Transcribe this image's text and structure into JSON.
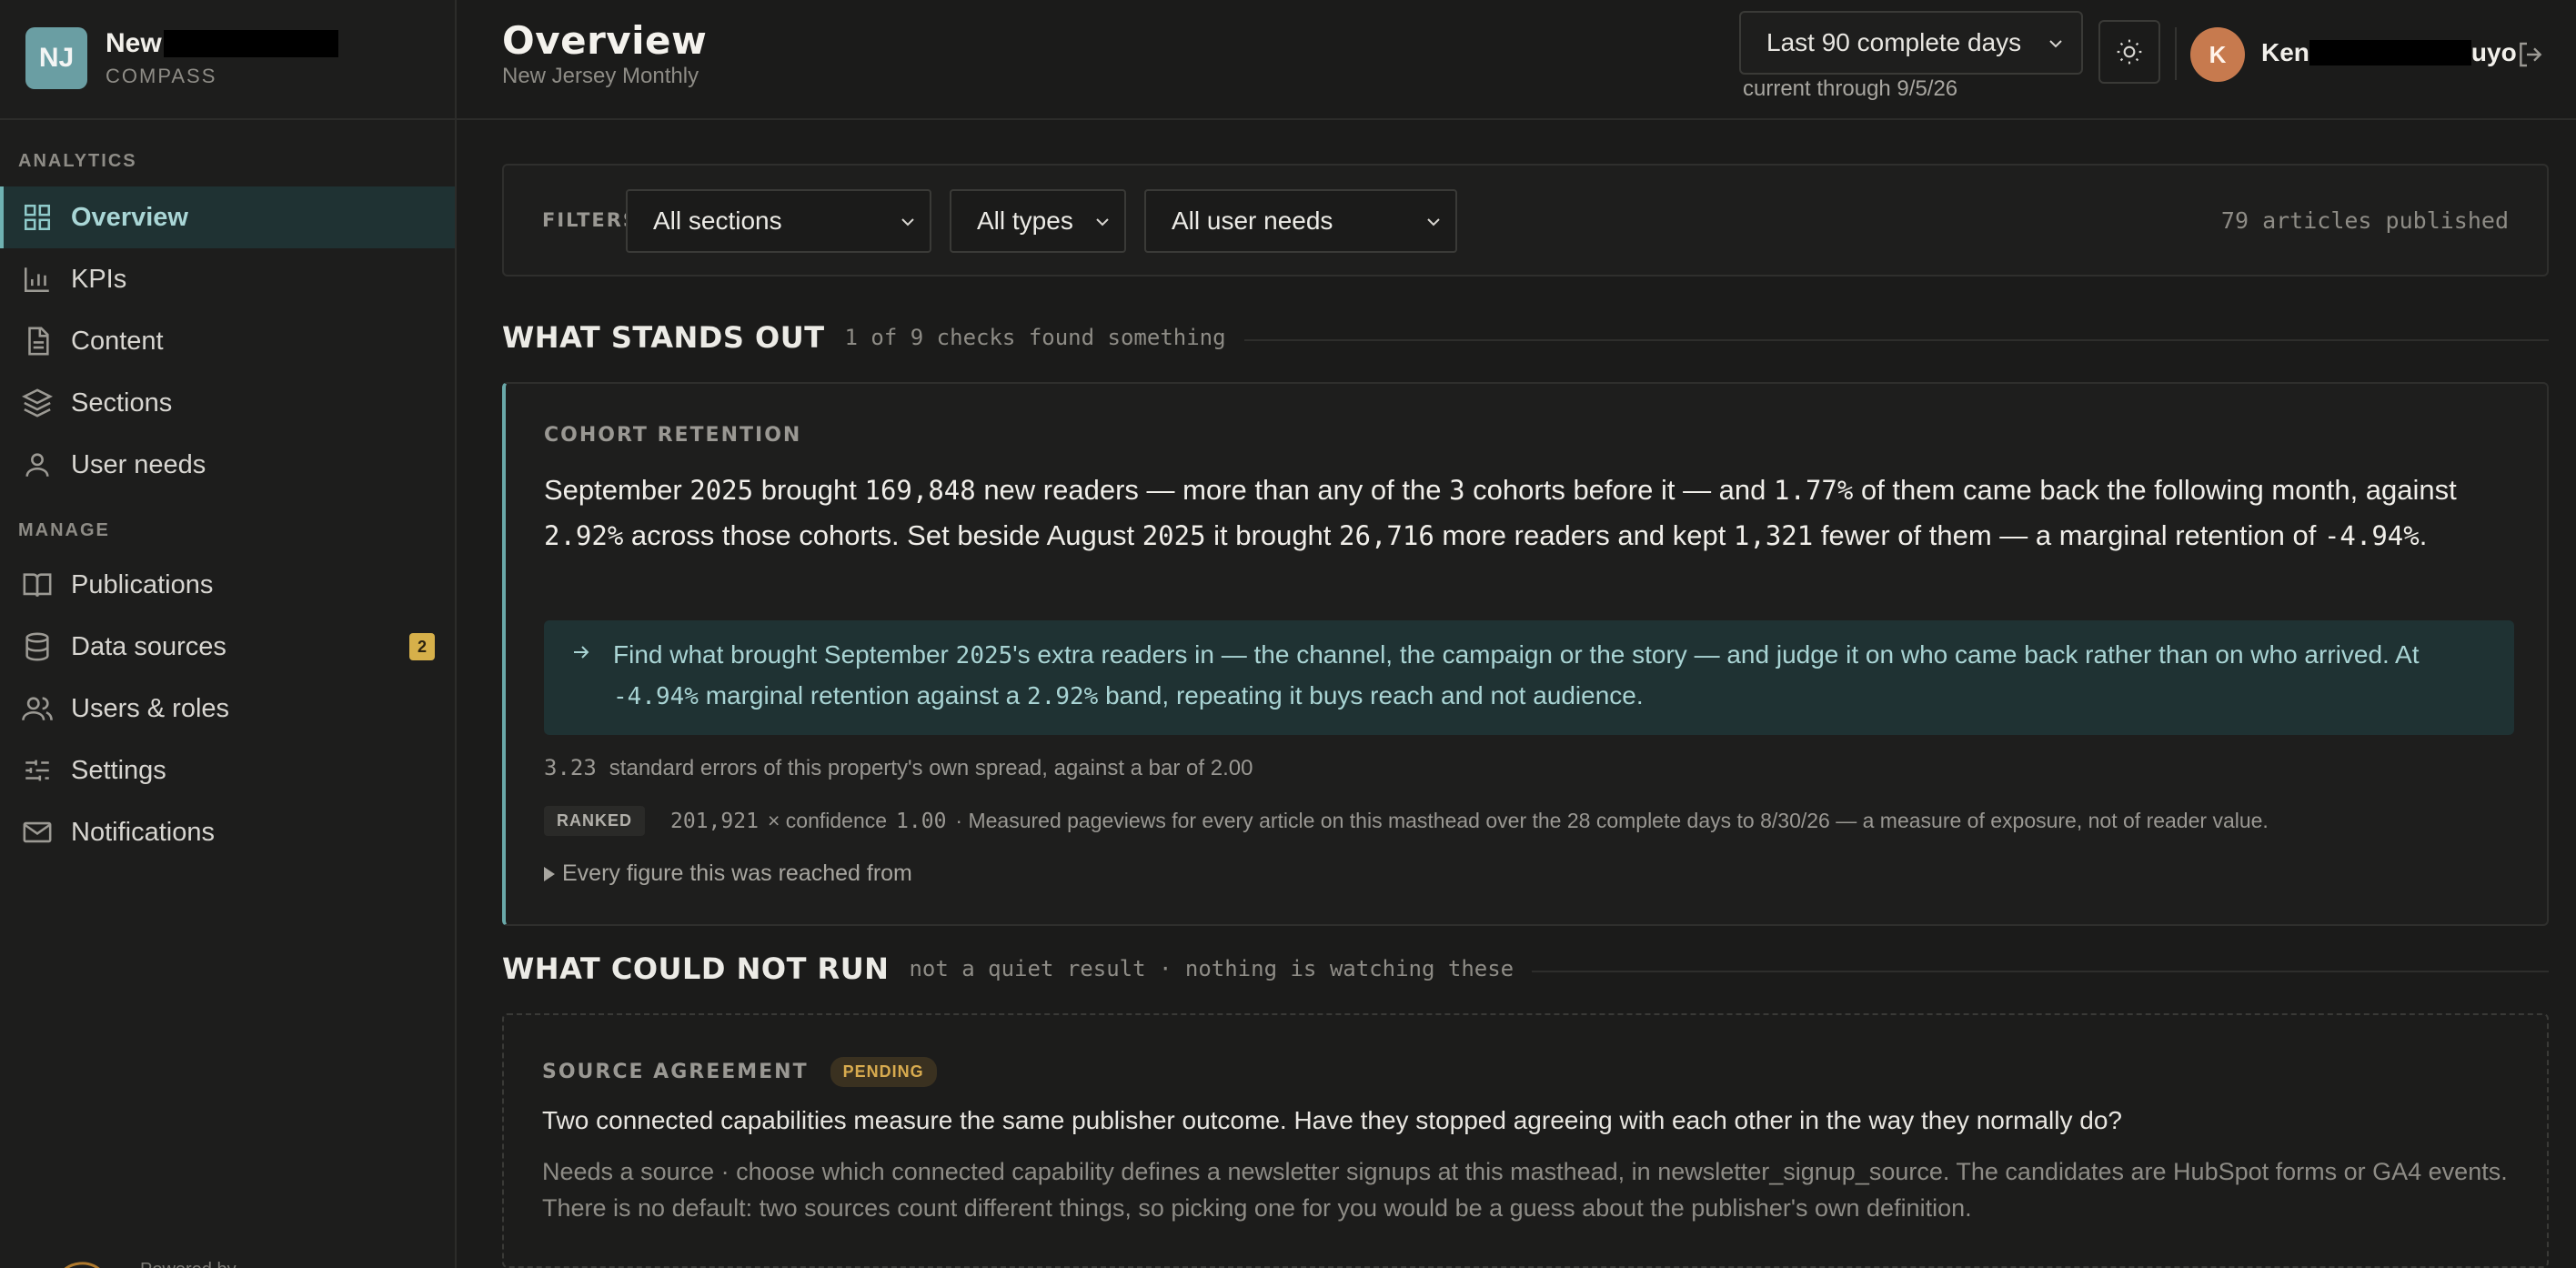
{
  "brand": {
    "initials": "NJ",
    "name": "New",
    "product": "COMPASS"
  },
  "sidebar": {
    "sections": [
      {
        "label": "ANALYTICS"
      },
      {
        "label": "MANAGE"
      }
    ],
    "items": [
      {
        "label": "Overview",
        "icon": "grid-icon",
        "active": true
      },
      {
        "label": "KPIs",
        "icon": "bar-chart-icon"
      },
      {
        "label": "Content",
        "icon": "document-icon"
      },
      {
        "label": "Sections",
        "icon": "layers-icon"
      },
      {
        "label": "User needs",
        "icon": "user-icon"
      },
      {
        "label": "Publications",
        "icon": "book-icon"
      },
      {
        "label": "Data sources",
        "icon": "database-icon",
        "badge": "2"
      },
      {
        "label": "Users & roles",
        "icon": "users-icon"
      },
      {
        "label": "Settings",
        "icon": "sliders-icon"
      },
      {
        "label": "Notifications",
        "icon": "mail-icon"
      }
    ],
    "powered": "Powered by"
  },
  "header": {
    "title": "Overview",
    "subtitle": "New Jersey Monthly",
    "date_range": "Last 90 complete days",
    "through": "current through 9/5/26",
    "user_initial": "K",
    "user_name_start": "Ken",
    "user_name_end": "uyo"
  },
  "filters": {
    "label": "FILTERS",
    "sections": "All sections",
    "types": "All types",
    "needs": "All user needs",
    "count": "79 articles published"
  },
  "stands_out": {
    "title": "WHAT STANDS OUT",
    "subtitle": "1 of 9 checks found something",
    "card": {
      "kicker": "COHORT RETENTION",
      "lead": [
        "September ",
        "2025",
        " brought ",
        "169,848",
        " new readers — more than any of the ",
        "3",
        " cohorts before it — and ",
        "1.77%",
        " of them came back the following month, against ",
        "2.92%",
        " across those cohorts. Set beside August ",
        "2025",
        " it brought ",
        "26,716",
        " more readers and kept ",
        "1,321",
        " fewer of them — a marginal retention of ",
        "-4.94%",
        "."
      ],
      "recommendation": [
        "Find what brought September ",
        "2025",
        "'s extra readers in — the channel, the campaign or the story — and judge it on who came back rather than on who arrived. At ",
        "-4.94%",
        " marginal retention against a ",
        "2.92%",
        " band, repeating it buys reach and not audience."
      ],
      "stat_value": "3.23",
      "stat_text": "standard errors of this property's own spread, against a bar of 2.00",
      "ranked_label": "RANKED",
      "ranked_value": "201,921",
      "ranked_mid": "× confidence",
      "ranked_conf": "1.00",
      "ranked_text": "· Measured pageviews for every article on this masthead over the 28 complete days to 8/30/26 — a measure of exposure, not of reader value.",
      "disclose": "Every figure this was reached from"
    }
  },
  "could_not_run": {
    "title": "WHAT COULD NOT RUN",
    "subtitle": "not a quiet result · nothing is watching these",
    "card": {
      "kicker": "SOURCE AGREEMENT",
      "status": "PENDING",
      "question": "Two connected capabilities measure the same publisher outcome. Have they stopped agreeing with each other in the way they normally do?",
      "need": "Needs a source · choose which connected capability defines a newsletter signups at this masthead, in newsletter_signup_source. The candidates are HubSpot forms or GA4 events. There is no default: two sources count different things, so picking one for you would be a guess about the publisher's own definition."
    }
  },
  "colors": {
    "accent": "#6fb2b2",
    "background": "#1b1b1a",
    "badge": "#d6b04a",
    "avatar": "#c77a4e"
  }
}
